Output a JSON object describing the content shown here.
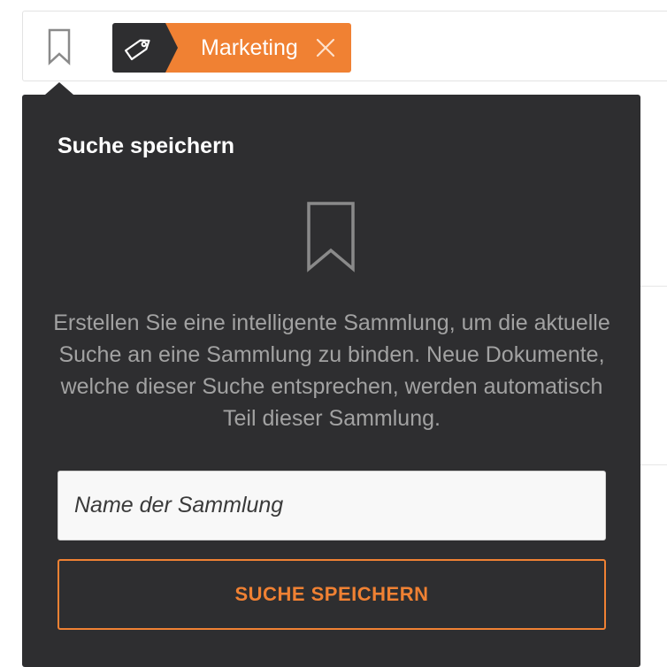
{
  "filter_bar": {
    "bookmark_icon": "bookmark-outline-icon",
    "tag": {
      "icon": "tag-icon",
      "label": "Marketing",
      "remove_icon": "close-icon"
    }
  },
  "popover": {
    "title": "Suche speichern",
    "illustration_icon": "bookmark-outline-icon",
    "description": "Erstellen Sie eine intelligente Sammlung, um die aktuelle Suche an eine Sammlung zu binden. Neue Dokumente, welche dieser Suche entsprechen, werden automatisch Teil dieser Sammlung.",
    "name_input": {
      "placeholder": "Name der Sammlung",
      "value": ""
    },
    "save_button_label": "SUCHE SPEICHERN"
  },
  "colors": {
    "accent": "#f08133",
    "panel": "#2e2e30",
    "text_muted": "#a2a2a2",
    "text_light": "#ffffff"
  }
}
